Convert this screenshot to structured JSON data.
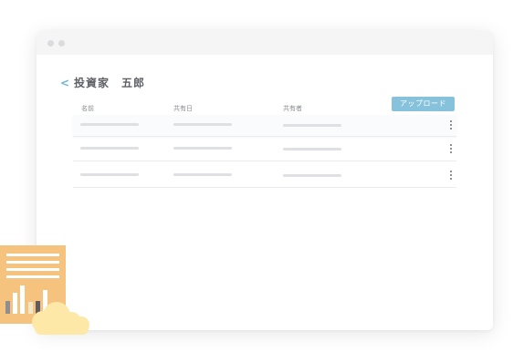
{
  "page": {
    "back_label": "<",
    "title": "投資家　五郎"
  },
  "toolbar": {
    "upload_label": "アップロード"
  },
  "table": {
    "headers": [
      "名前",
      "共有日",
      "共有者"
    ],
    "rows": [
      {
        "name": "",
        "date": "",
        "owner": ""
      },
      {
        "name": "",
        "date": "",
        "owner": ""
      },
      {
        "name": "",
        "date": "",
        "owner": ""
      }
    ]
  },
  "colors": {
    "accent": "#87c2dc",
    "back_arrow": "#6bb5d6",
    "document": "#f6c37f",
    "cloud": "#fde8a8"
  },
  "icons": {
    "back": "chevron-left-icon",
    "row_menu": "more-vertical-icon",
    "illustration": "document-chart-icon",
    "cloud": "cloud-icon"
  }
}
